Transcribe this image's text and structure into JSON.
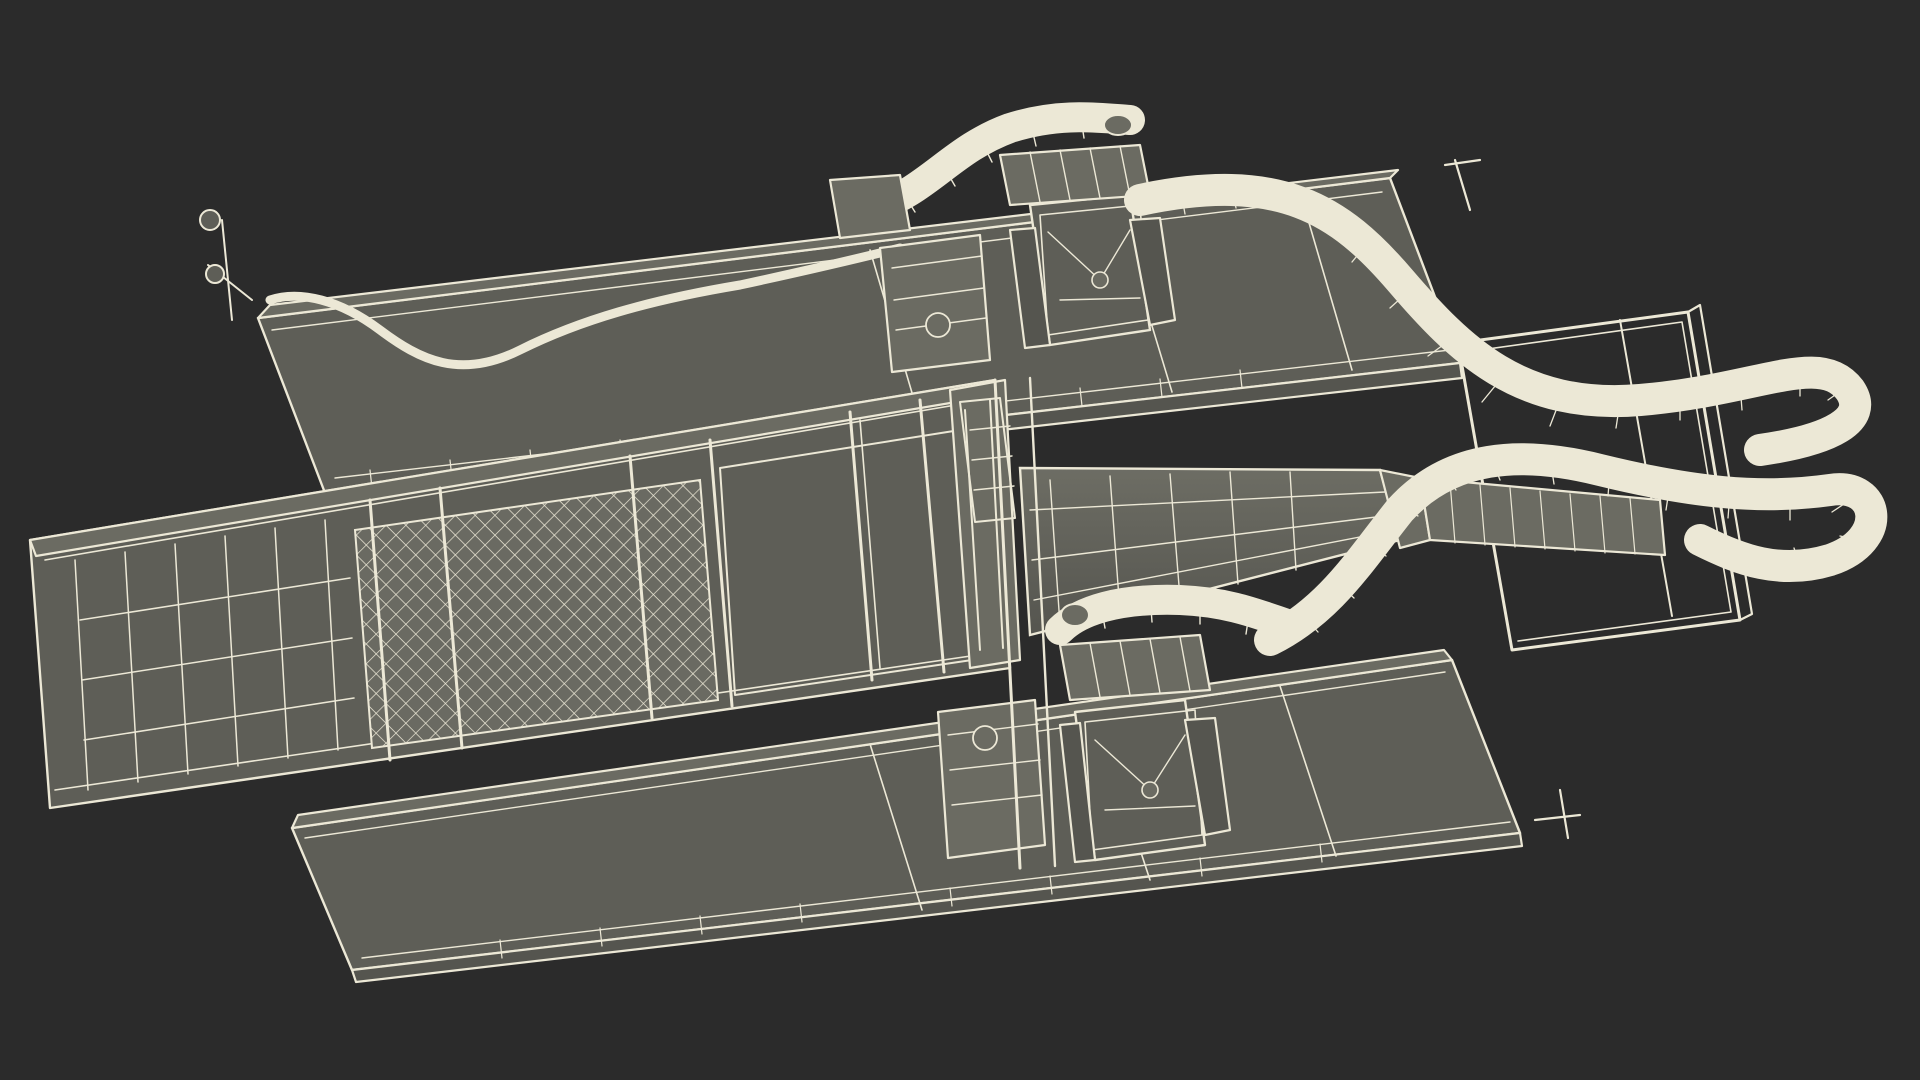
{
  "scene": {
    "subject": "wireframe-render-of-gold-dredge",
    "colors": {
      "background": "#2b2b2b",
      "surface": "#5e5e57",
      "wire": "#ece8d6"
    }
  }
}
